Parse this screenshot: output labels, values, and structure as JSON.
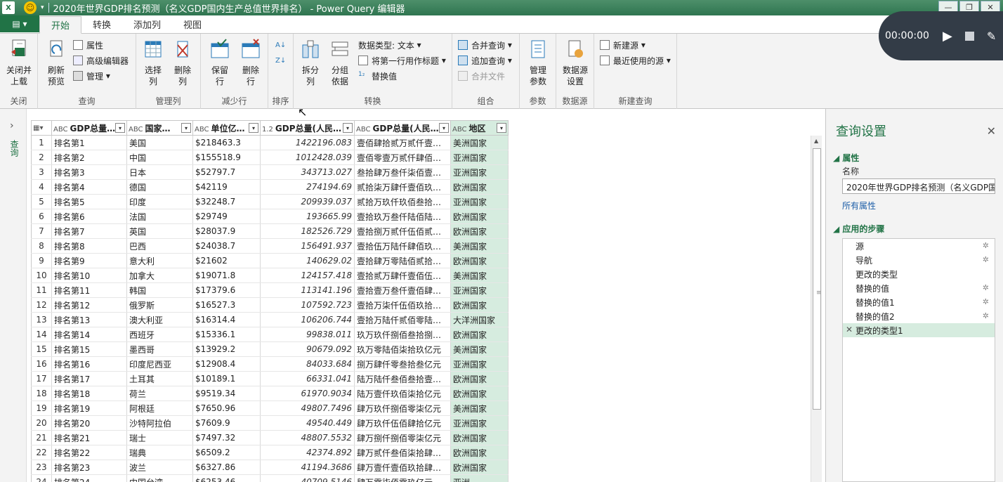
{
  "titlebar": {
    "app_icon": "X",
    "title": "2020年世界GDP排名预测（名义GDP国内生产总值世界排名） - Power Query 编辑器",
    "min": "—",
    "max": "❐",
    "close": "✕"
  },
  "tabs": {
    "file": "▤ ▾",
    "items": [
      "开始",
      "转换",
      "添加列",
      "视图"
    ]
  },
  "ribbon": {
    "close_group": {
      "btn": "关闭并上载",
      "label": "关闭"
    },
    "query_group": {
      "refresh": "刷新预览",
      "props": "属性",
      "adv_editor": "高级编辑器",
      "manage": "管理",
      "label": "查询"
    },
    "manage_cols": {
      "choose": "选择列",
      "remove": "删除列",
      "label": "管理列"
    },
    "reduce_rows": {
      "keep": "保留行",
      "remove": "删除行",
      "label": "减少行"
    },
    "sort": {
      "label": "排序"
    },
    "transform": {
      "split": "拆分列",
      "group": "分组依据",
      "datatype": "数据类型: 文本",
      "first_row": "将第一行用作标题",
      "replace": "替换值",
      "label": "转换"
    },
    "combine": {
      "merge": "合并查询",
      "append": "追加查询",
      "files": "合并文件",
      "label": "组合"
    },
    "params": {
      "btn": "管理参数",
      "label": "参数"
    },
    "datasource": {
      "btn": "数据源设置",
      "label": "数据源"
    },
    "newquery": {
      "new": "新建源",
      "recent": "最近使用的源",
      "label": "新建查询"
    }
  },
  "recorder": {
    "time": "00:00:00"
  },
  "left_pane": {
    "label": "查询"
  },
  "grid": {
    "columns": [
      {
        "type": "ABC",
        "name": "GDP总量…"
      },
      {
        "type": "ABC",
        "name": "国家…"
      },
      {
        "type": "ABC",
        "name": "单位亿…"
      },
      {
        "type": "1.2",
        "name": "GDP总量(人民…"
      },
      {
        "type": "ABC",
        "name": "GDP总量(人民…"
      },
      {
        "type": "ABC",
        "name": "地区"
      }
    ],
    "rows": [
      [
        "1",
        "排名第1",
        "美国",
        "$218463.3",
        "1422196.083",
        "壹佰肆拾贰万贰仟壹…",
        "美洲国家"
      ],
      [
        "2",
        "排名第2",
        "中国",
        "$155518.9",
        "1012428.039",
        "壹佰零壹万贰仟肆佰…",
        "亚洲国家"
      ],
      [
        "3",
        "排名第3",
        "日本",
        "$52797.7",
        "343713.027",
        "叁拾肆万叁仟柒佰壹…",
        "亚洲国家"
      ],
      [
        "4",
        "排名第4",
        "德国",
        "$42119",
        "274194.69",
        "贰拾柒万肆仟壹佰玖…",
        "欧洲国家"
      ],
      [
        "5",
        "排名第5",
        "印度",
        "$32248.7",
        "209939.037",
        "贰拾万玖仟玖佰叁拾…",
        "亚洲国家"
      ],
      [
        "6",
        "排名第6",
        "法国",
        "$29749",
        "193665.99",
        "壹拾玖万叁仟陆佰陆…",
        "欧洲国家"
      ],
      [
        "7",
        "排名第7",
        "英国",
        "$28037.9",
        "182526.729",
        "壹拾捌万贰仟伍佰贰…",
        "欧洲国家"
      ],
      [
        "8",
        "排名第8",
        "巴西",
        "$24038.7",
        "156491.937",
        "壹拾伍万陆仟肆佰玖…",
        "美洲国家"
      ],
      [
        "9",
        "排名第9",
        "意大利",
        "$21602",
        "140629.02",
        "壹拾肆万零陆佰贰拾…",
        "欧洲国家"
      ],
      [
        "10",
        "排名第10",
        "加拿大",
        "$19071.8",
        "124157.418",
        "壹拾贰万肆仟壹佰伍…",
        "美洲国家"
      ],
      [
        "11",
        "排名第11",
        "韩国",
        "$17379.6",
        "113141.196",
        "壹拾壹万叁仟壹佰肆…",
        "亚洲国家"
      ],
      [
        "12",
        "排名第12",
        "俄罗斯",
        "$16527.3",
        "107592.723",
        "壹拾万柒仟伍佰玖拾…",
        "欧洲国家"
      ],
      [
        "13",
        "排名第13",
        "澳大利亚",
        "$16314.4",
        "106206.744",
        "壹拾万陆仟贰佰零陆…",
        "大洋洲国家"
      ],
      [
        "14",
        "排名第14",
        "西班牙",
        "$15336.1",
        "99838.011",
        "玖万玖仟捌佰叁拾捌…",
        "欧洲国家"
      ],
      [
        "15",
        "排名第15",
        "墨西哥",
        "$13929.2",
        "90679.092",
        "玖万零陆佰柒拾玖亿元",
        "美洲国家"
      ],
      [
        "16",
        "排名第16",
        "印度尼西亚",
        "$12908.4",
        "84033.684",
        "捌万肆仟零叁拾叁亿元",
        "亚洲国家"
      ],
      [
        "17",
        "排名第17",
        "土耳其",
        "$10189.1",
        "66331.041",
        "陆万陆仟叁佰叁拾壹…",
        "欧洲国家"
      ],
      [
        "18",
        "排名第18",
        "荷兰",
        "$9519.34",
        "61970.9034",
        "陆万壹仟玖佰柒拾亿元",
        "欧洲国家"
      ],
      [
        "19",
        "排名第19",
        "阿根廷",
        "$7650.96",
        "49807.7496",
        "肆万玖仟捌佰零柒亿元",
        "美洲国家"
      ],
      [
        "20",
        "排名第20",
        "沙特阿拉伯",
        "$7609.9",
        "49540.449",
        "肆万玖仟伍佰肆拾亿元",
        "亚洲国家"
      ],
      [
        "21",
        "排名第21",
        "瑞士",
        "$7497.32",
        "48807.5532",
        "肆万捌仟捌佰零柒亿元",
        "欧洲国家"
      ],
      [
        "22",
        "排名第22",
        "瑞典",
        "$6509.2",
        "42374.892",
        "肆万贰仟叁佰柒拾肆…",
        "欧洲国家"
      ],
      [
        "23",
        "排名第23",
        "波兰",
        "$6327.86",
        "41194.3686",
        "肆万壹仟壹佰玖拾肆…",
        "欧洲国家"
      ],
      [
        "24",
        "排名第24",
        "中国台湾",
        "$6253.46",
        "40709.5146",
        "肆万零柒佰零玖亿元",
        "亚洲"
      ]
    ]
  },
  "settings": {
    "title": "查询设置",
    "props_header": "属性",
    "name_label": "名称",
    "name_value": "2020年世界GDP排名预测（名义GDP国内",
    "all_props": "所有属性",
    "steps_header": "应用的步骤",
    "steps": [
      {
        "label": "源",
        "gear": true
      },
      {
        "label": "导航",
        "gear": true
      },
      {
        "label": "更改的类型",
        "gear": false
      },
      {
        "label": "替换的值",
        "gear": true
      },
      {
        "label": "替换的值1",
        "gear": true
      },
      {
        "label": "替换的值2",
        "gear": true
      },
      {
        "label": "更改的类型1",
        "gear": false,
        "selected": true
      }
    ]
  },
  "colors": {
    "accent": "#217346",
    "selected": "#d6ecdf",
    "link": "#1e5fa8"
  }
}
